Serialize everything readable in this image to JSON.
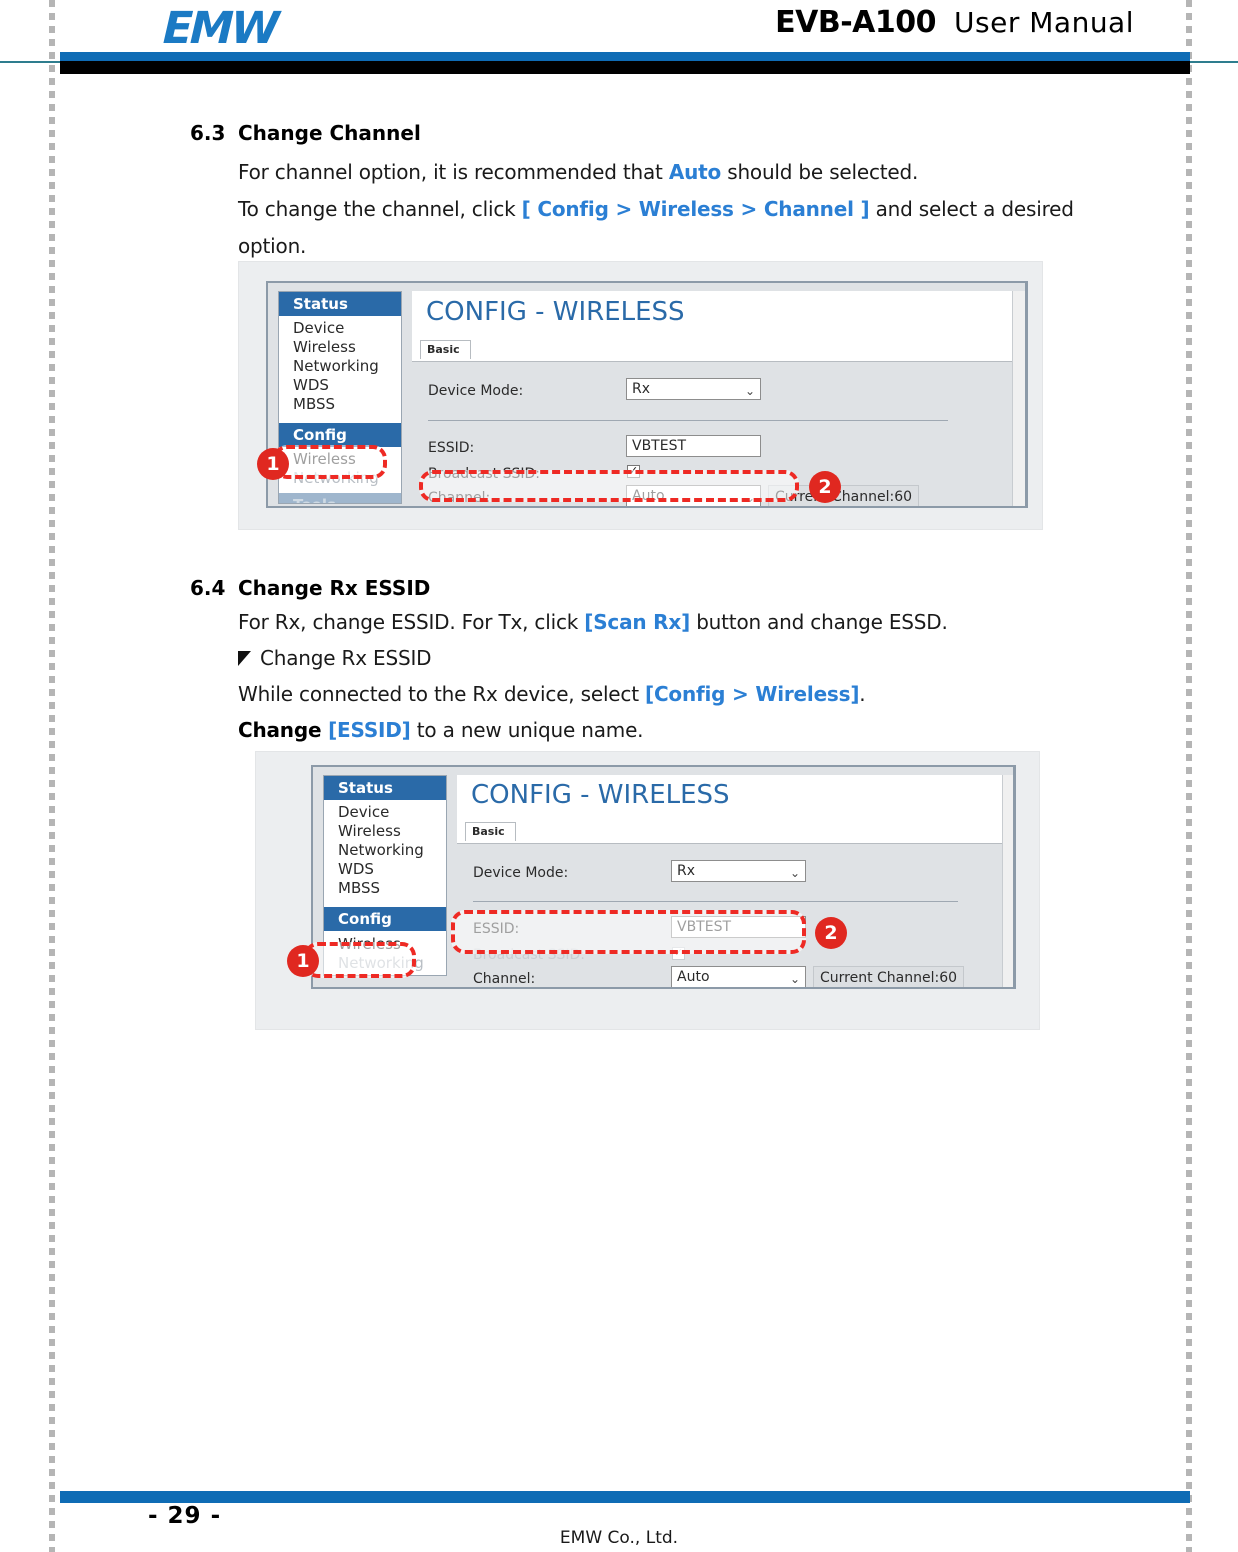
{
  "header": {
    "logo_text": "EMW",
    "model": "EVB-A100",
    "manual": "User  Manual"
  },
  "sections": [
    {
      "number": "6.3",
      "title": "Change Channel",
      "paragraphs": [
        {
          "id": "p1",
          "parts": [
            {
              "t": "For channel option, it is recommended that ",
              "style": "plain"
            },
            {
              "t": "Auto",
              "style": "blue"
            },
            {
              "t": " should be selected.",
              "style": "plain"
            }
          ]
        },
        {
          "id": "p2",
          "parts": [
            {
              "t": "To change the channel, click ",
              "style": "plain"
            },
            {
              "t": "[ Config > Wireless > Channel ]",
              "style": "blue"
            },
            {
              "t": " and select a desired",
              "style": "plain"
            }
          ]
        },
        {
          "id": "p3",
          "parts": [
            {
              "t": "option.",
              "style": "plain"
            }
          ]
        }
      ]
    },
    {
      "number": "6.4",
      "title": "Change Rx ESSID",
      "paragraphs": [
        {
          "id": "p1",
          "parts": [
            {
              "t": "For Rx, change ESSID. For Tx, click ",
              "style": "plain"
            },
            {
              "t": "[Scan Rx]",
              "style": "blue"
            },
            {
              "t": " button and change ESSD.",
              "style": "plain"
            }
          ]
        },
        {
          "id": "p2",
          "bullet": true,
          "parts": [
            {
              "t": "Change Rx ESSID",
              "style": "plain"
            }
          ]
        },
        {
          "id": "p3",
          "parts": [
            {
              "t": "While connected to the Rx device, select ",
              "style": "plain"
            },
            {
              "t": "[Config > Wireless]",
              "style": "blue"
            },
            {
              "t": ".",
              "style": "plain"
            }
          ]
        },
        {
          "id": "p4",
          "parts": [
            {
              "t": "Change ",
              "style": "bold"
            },
            {
              "t": "[ESSID]",
              "style": "blue"
            },
            {
              "t": " to a new unique name.",
              "style": "plain"
            }
          ]
        }
      ]
    }
  ],
  "screenshot_1": {
    "caption_context": "CONFIG - WIRELESS channel selection",
    "nav": {
      "status_header": "Status",
      "status_items": [
        "Device",
        "Wireless",
        "Networking",
        "WDS",
        "MBSS"
      ],
      "config_header": "Config",
      "config_items": [
        "Wireless",
        "Networking"
      ],
      "tools_header": "Tools"
    },
    "panel_title": "CONFIG - WIRELESS",
    "tab": "Basic",
    "fields": [
      {
        "label": "Device Mode:",
        "value": "Rx",
        "type": "select"
      },
      {
        "label": "ESSID:",
        "value": "VBTEST",
        "type": "input"
      },
      {
        "label": "Broadcast SSID:",
        "value": "✓",
        "type": "checkbox"
      },
      {
        "label": "Channel:",
        "value": "Auto",
        "type": "select"
      }
    ],
    "current_channel": "Current Channel:60",
    "current_channel_visible": "nt Channel:60",
    "badges": [
      "1",
      "2"
    ]
  },
  "screenshot_2": {
    "caption_context": "CONFIG - WIRELESS ESSID field",
    "nav": {
      "status_header": "Status",
      "status_items": [
        "Device",
        "Wireless",
        "Networking",
        "WDS",
        "MBSS"
      ],
      "config_header": "Config",
      "config_items": [
        "Wireless",
        "Networking"
      ]
    },
    "panel_title": "CONFIG - WIRELESS",
    "tab": "Basic",
    "fields": [
      {
        "label": "Device Mode:",
        "value": "Rx",
        "type": "select"
      },
      {
        "label": "ESSID:",
        "value": "VBTEST",
        "type": "input"
      },
      {
        "label": "Broadcast SSID:",
        "value": "✓",
        "type": "checkbox"
      },
      {
        "label": "Channel:",
        "value": "Auto",
        "type": "select"
      }
    ],
    "current_channel": "Current Channel:60",
    "badges": [
      "1",
      "2"
    ]
  },
  "footer": {
    "page_number": "- 29 -",
    "company": "EMW Co., Ltd."
  },
  "colors": {
    "brand_blue": "#0f6cb5",
    "link_blue": "#2b7fd4",
    "annotation_red": "#ee2a24",
    "nav_header_blue": "#2a6aa8",
    "rule_teal": "#2e7d8e"
  }
}
